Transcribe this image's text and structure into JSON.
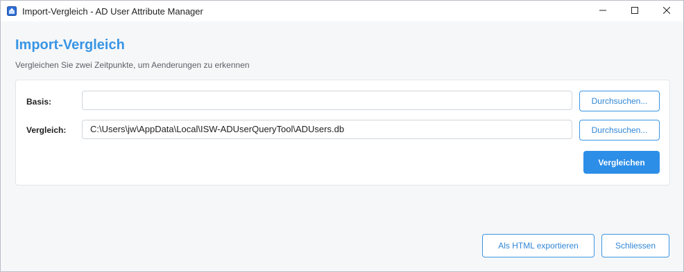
{
  "window": {
    "title": "Import-Vergleich - AD User Attribute Manager",
    "controls": {
      "minimize_icon": "minimize-icon",
      "maximize_icon": "maximize-icon",
      "close_icon": "close-icon"
    }
  },
  "header": {
    "title": "Import-Vergleich",
    "subtitle": "Vergleichen Sie zwei Zeitpunkte, um Aenderungen zu erkennen"
  },
  "form": {
    "basis": {
      "label": "Basis:",
      "value": "",
      "browse_label": "Durchsuchen..."
    },
    "vergleich": {
      "label": "Vergleich:",
      "value": "C:\\Users\\jw\\AppData\\Local\\ISW-ADUserQueryTool\\ADUsers.db",
      "browse_label": "Durchsuchen..."
    },
    "compare_label": "Vergleichen"
  },
  "footer": {
    "export_label": "Als HTML exportieren",
    "close_label": "Schliessen"
  },
  "colors": {
    "accent": "#3895e4",
    "primary_button": "#2d8ee8",
    "background": "#f6f7f9"
  }
}
